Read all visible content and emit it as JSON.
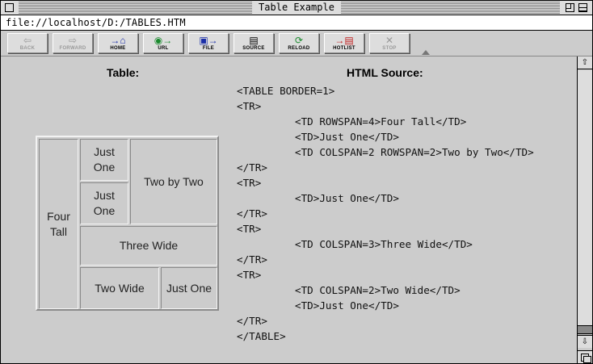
{
  "window": {
    "title": "Table Example"
  },
  "url": "file://localhost/D:/TABLES.HTM",
  "toolbar": {
    "buttons": [
      {
        "label": "BACK",
        "icon": "left-arrow-icon",
        "glyph": "⇦",
        "enabled": false
      },
      {
        "label": "FORWARD",
        "icon": "right-arrow-icon",
        "glyph": "⇨",
        "enabled": false
      },
      {
        "label": "HOME",
        "icon": "home-icon",
        "glyph": "→⌂",
        "enabled": true
      },
      {
        "label": "URL",
        "icon": "globe-icon",
        "glyph": "◉→",
        "enabled": true
      },
      {
        "label": "FILE",
        "icon": "floppy-disk-icon",
        "glyph": "▣→",
        "enabled": true
      },
      {
        "label": "SOURCE",
        "icon": "document-icon",
        "glyph": "▤",
        "enabled": true
      },
      {
        "label": "RELOAD",
        "icon": "reload-icon",
        "glyph": "⟳",
        "enabled": true
      },
      {
        "label": "HOTLIST",
        "icon": "hotlist-icon",
        "glyph": "→▤",
        "enabled": true
      },
      {
        "label": "STOP",
        "icon": "stop-icon",
        "glyph": "✕",
        "enabled": false
      }
    ]
  },
  "content": {
    "table_heading": "Table:",
    "source_heading": "HTML Source:",
    "demo_table": {
      "four_tall": "Four Tall",
      "just_one_a": "Just One",
      "just_one_b": "Just One",
      "two_by_two": "Two by Two",
      "three_wide": "Three Wide",
      "two_wide": "Two Wide",
      "just_one_c": "Just One"
    },
    "source_lines": [
      {
        "text": "<TABLE BORDER=1>",
        "indent": false
      },
      {
        "text": "<TR>",
        "indent": false
      },
      {
        "text": "<TD ROWSPAN=4>Four Tall</TD>",
        "indent": true
      },
      {
        "text": "<TD>Just One</TD>",
        "indent": true
      },
      {
        "text": "<TD COLSPAN=2 ROWSPAN=2>Two by Two</TD>",
        "indent": true
      },
      {
        "text": "</TR>",
        "indent": false
      },
      {
        "text": "<TR>",
        "indent": false
      },
      {
        "text": "<TD>Just One</TD>",
        "indent": true
      },
      {
        "text": "</TR>",
        "indent": false
      },
      {
        "text": "<TR>",
        "indent": false
      },
      {
        "text": "<TD COLSPAN=3>Three Wide</TD>",
        "indent": true
      },
      {
        "text": "</TR>",
        "indent": false
      },
      {
        "text": "<TR>",
        "indent": false
      },
      {
        "text": "<TD COLSPAN=2>Two Wide</TD>",
        "indent": true
      },
      {
        "text": "<TD>Just One</TD>",
        "indent": true
      },
      {
        "text": "</TR>",
        "indent": false
      },
      {
        "text": "</TABLE>",
        "indent": false
      }
    ]
  },
  "scrollbar": {
    "up_glyph": "⇧",
    "down_glyph": "⇩"
  }
}
